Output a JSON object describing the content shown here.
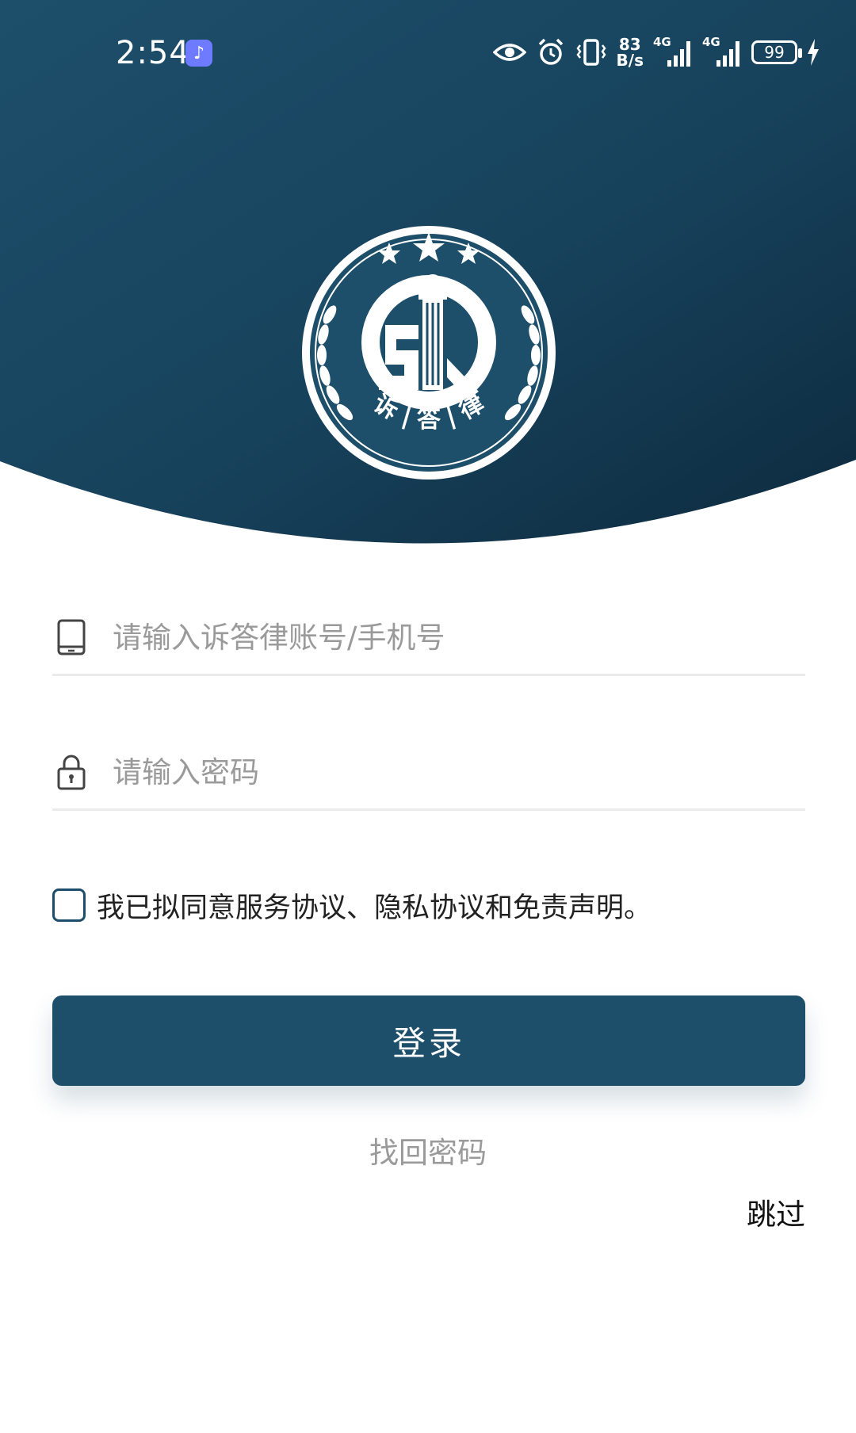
{
  "status_bar": {
    "time": "2:54",
    "net_speed_value": "83",
    "net_speed_unit": "B/s",
    "signal1_label": "4G",
    "signal2_label": "4G",
    "battery": "99"
  },
  "logo": {
    "text": "诉 | 答 | 律"
  },
  "form": {
    "account_placeholder": "请输入诉答律账号/手机号",
    "password_placeholder": "请输入密码",
    "agreement_text": "我已拟同意服务协议、隐私协议和免责声明。",
    "login_label": "登录",
    "find_password_label": "找回密码",
    "skip_label": "跳过"
  },
  "colors": {
    "header_dark": "#0f2f44",
    "header_light": "#1f5673",
    "primary": "#1d4f6b"
  }
}
